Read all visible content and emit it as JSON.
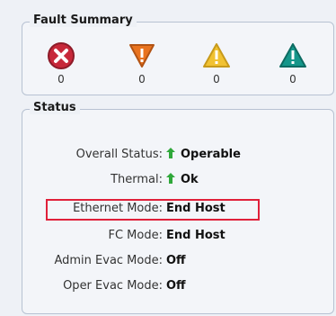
{
  "fault_summary": {
    "title": "Fault Summary",
    "items": [
      {
        "icon": "critical-x-icon",
        "color": "#c7283a",
        "count": "0"
      },
      {
        "icon": "major-down-triangle-icon",
        "color": "#e9731f",
        "count": "0"
      },
      {
        "icon": "minor-warning-triangle-icon",
        "color": "#f1c232",
        "count": "0"
      },
      {
        "icon": "warning-triangle-icon",
        "color": "#15968a",
        "count": "0"
      }
    ]
  },
  "status": {
    "title": "Status",
    "rows": [
      {
        "label": "Overall Status:",
        "value": "Operable",
        "icon": "green-up-arrow-icon"
      },
      {
        "label": "Thermal:",
        "value": "Ok",
        "icon": "green-up-arrow-icon"
      },
      {
        "label": "Ethernet Mode:",
        "value": "End Host"
      },
      {
        "label": "FC Mode:",
        "value": "End Host"
      },
      {
        "label": "Admin Evac Mode:",
        "value": "Off"
      },
      {
        "label": "Oper Evac Mode:",
        "value": "Off"
      }
    ],
    "highlighted_row": "Ethernet Mode"
  }
}
